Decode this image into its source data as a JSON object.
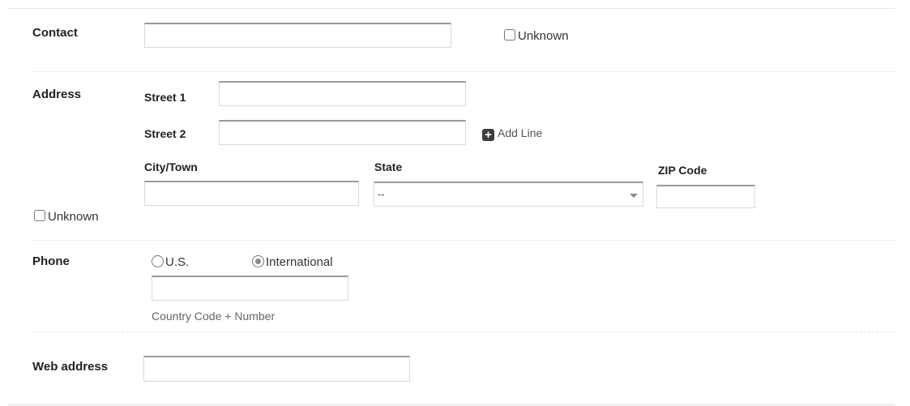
{
  "contact": {
    "label": "Contact",
    "unknown_label": "Unknown"
  },
  "address": {
    "label": "Address",
    "street1_label": "Street 1",
    "street2_label": "Street 2",
    "add_line_label": "Add Line",
    "city_label": "City/Town",
    "state_label": "State",
    "state_value": "--",
    "zip_label": "ZIP Code",
    "unknown_label": "Unknown"
  },
  "phone": {
    "label": "Phone",
    "options": [
      "U.S.",
      "International"
    ],
    "selected": "International",
    "hint": "Country Code + Number"
  },
  "web": {
    "label": "Web address"
  }
}
